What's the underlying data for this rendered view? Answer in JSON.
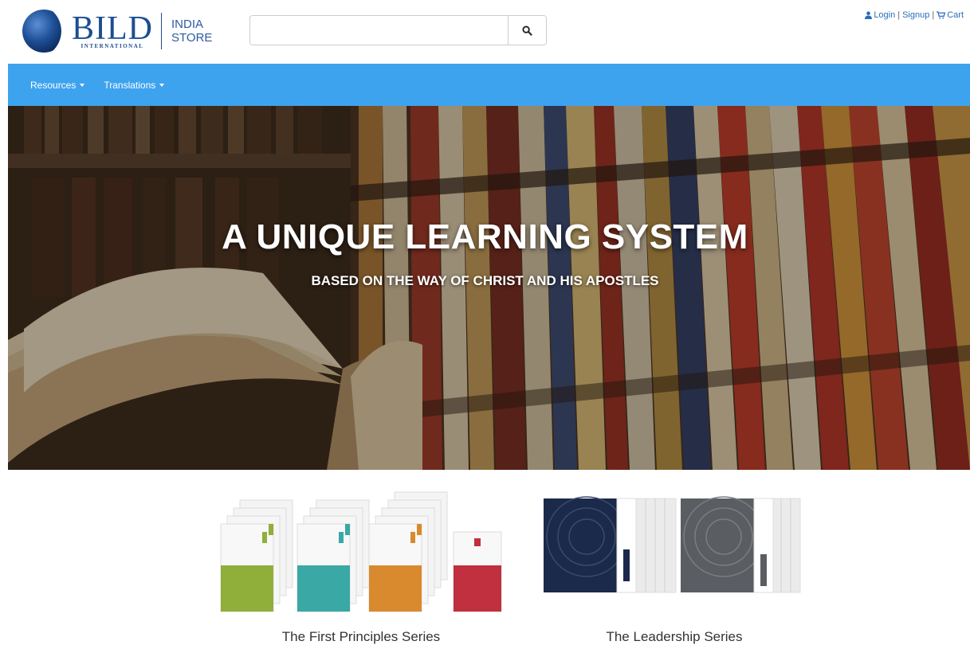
{
  "header": {
    "logo_name": "BILD",
    "logo_sub": "INTERNATIONAL",
    "store_line1": "INDIA",
    "store_line2": "STORE",
    "search": {
      "placeholder": "",
      "value": ""
    },
    "links": {
      "login": "Login",
      "signup": "Signup",
      "cart": "Cart"
    },
    "icons": {
      "user": "user-icon",
      "cart": "cart-icon",
      "search": "search-icon"
    }
  },
  "nav": {
    "items": [
      {
        "label": "Resources"
      },
      {
        "label": "Translations"
      }
    ],
    "color": "#3ea3ef"
  },
  "hero": {
    "title": "A UNIQUE LEARNING SYSTEM",
    "subtitle": "BASED ON THE WAY OF CHRIST AND HIS APOSTLES"
  },
  "series": [
    {
      "label": "The First Principles Series"
    },
    {
      "label": "The Leadership Series"
    }
  ]
}
